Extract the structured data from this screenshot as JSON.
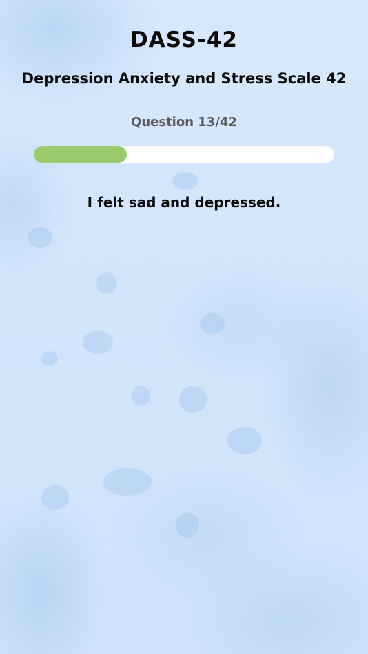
{
  "header": {
    "title": "DASS-42",
    "subtitle": "Depression Anxiety and Stress Scale 42"
  },
  "progress": {
    "label": "Question 13/42",
    "current": 13,
    "total": 42,
    "fill_color": "#9ccb6e",
    "track_color": "#ffffff"
  },
  "question": {
    "text": "I felt sad and depressed."
  },
  "theme": {
    "background": "#d4e6fb",
    "text_color": "#0a0a0a",
    "muted_text_color": "#5a5a5a"
  }
}
